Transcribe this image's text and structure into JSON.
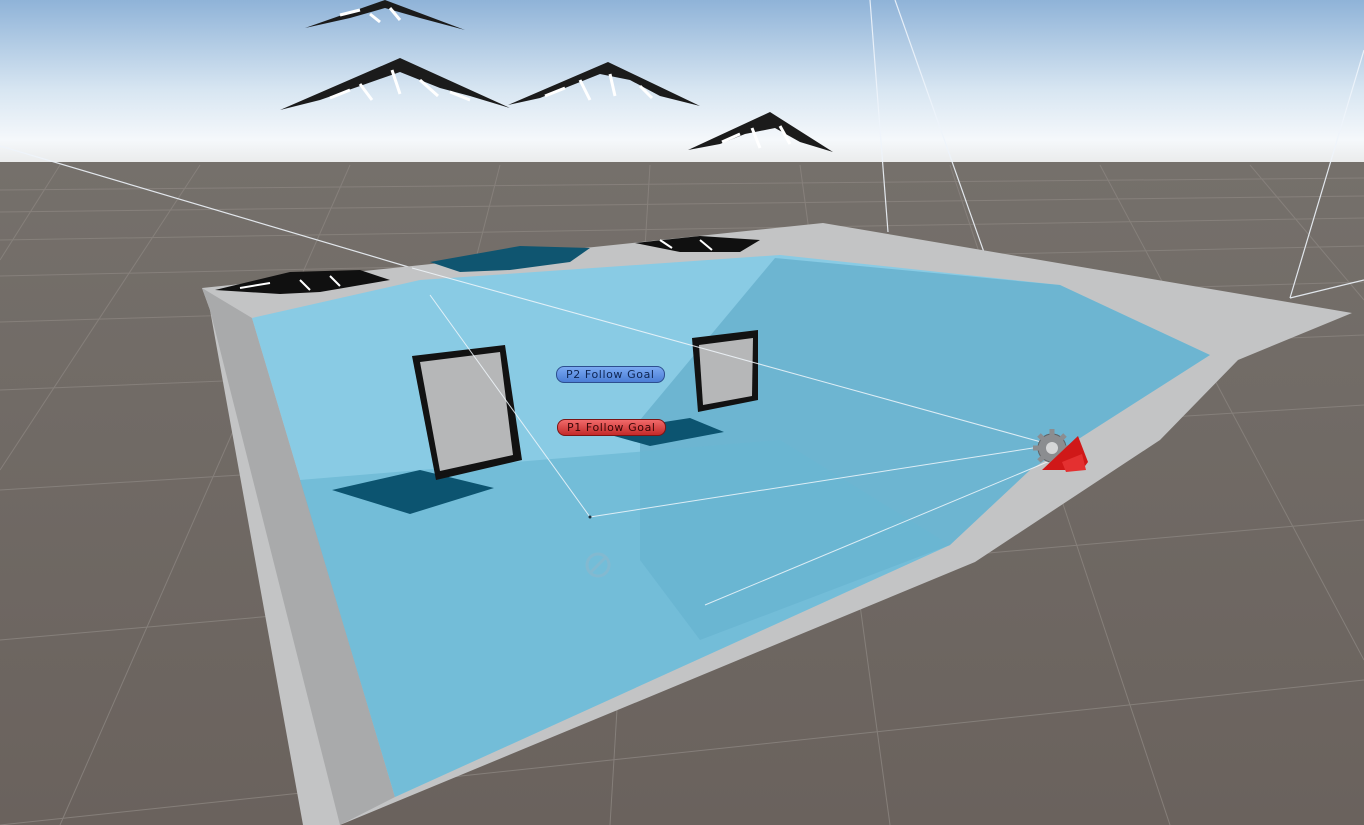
{
  "scene_view": {
    "labels": {
      "p2_goal": "P2 Follow Goal",
      "p1_goal": "P1 Follow Goal"
    },
    "icons": {
      "camera_gizmo": "camera-gizmo-icon",
      "settings_gear": "gear-icon",
      "transform_gizmo": "transform-handle-icon"
    },
    "colors": {
      "sky_top": "#93b6d8",
      "sky_horizon": "#ffffff",
      "ground": "#6d6661",
      "grid_line": "#8a8480",
      "floor_border": "#c2c3c4",
      "water": "#87cde7",
      "water_shadow": "#4d97b3",
      "panel": "#b4b5b6",
      "panel_frame": "#111111",
      "shadow": "#0d5671",
      "p2_label": "#5a8ae0",
      "p1_label": "#d83a3a",
      "camera_icon": "#d41a1a"
    }
  }
}
